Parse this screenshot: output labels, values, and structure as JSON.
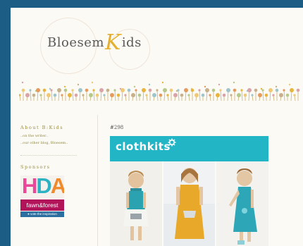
{
  "site": {
    "logo_left": "Bloesem",
    "logo_k": "K",
    "logo_right": "ids"
  },
  "sidebar": {
    "about_heading": "About B:Kids",
    "links": [
      "..on the writer..",
      "..our other blog, Bloesem.."
    ],
    "sponsors_heading": "Sponsors",
    "sponsor": {
      "letters": "HDA",
      "name": "fawn&forest",
      "tagline": "● vote the inspiration"
    }
  },
  "post": {
    "number": "#298",
    "banner_text": "clothkits",
    "banner_icon": "gear-icon"
  },
  "colors": {
    "frame": "#1b5d84",
    "page": "#fbfaf5",
    "logo_k": "#e3b12f",
    "banner": "#21b5c5",
    "sidebar_text": "#9a8d3e"
  }
}
